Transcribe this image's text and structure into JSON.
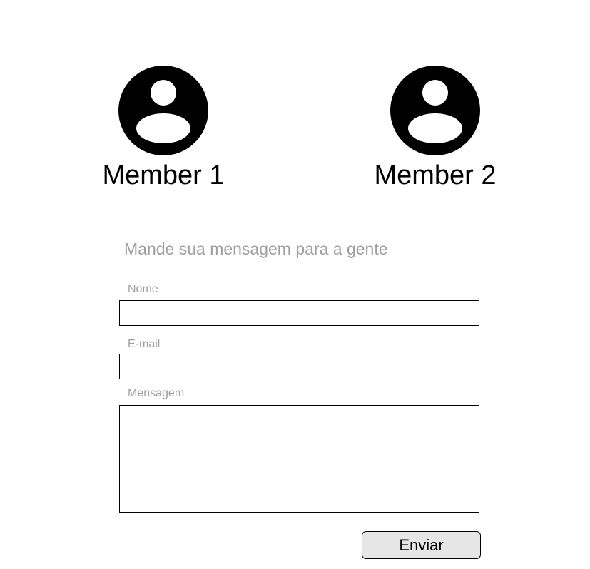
{
  "members": [
    {
      "name": "Member 1",
      "icon": "user-avatar-icon"
    },
    {
      "name": "Member 2",
      "icon": "user-avatar-icon"
    }
  ],
  "contact_form": {
    "heading": "Mande sua mensagem para a gente",
    "fields": {
      "name": {
        "label": "Nome",
        "value": ""
      },
      "email": {
        "label": "E-mail",
        "value": ""
      },
      "message": {
        "label": "Mensagem",
        "value": ""
      }
    },
    "submit_label": "Enviar"
  },
  "colors": {
    "text": "#000000",
    "muted_text": "#9e9e9e",
    "rule": "#d8d8d8",
    "button_bg": "#e6e6e6"
  }
}
